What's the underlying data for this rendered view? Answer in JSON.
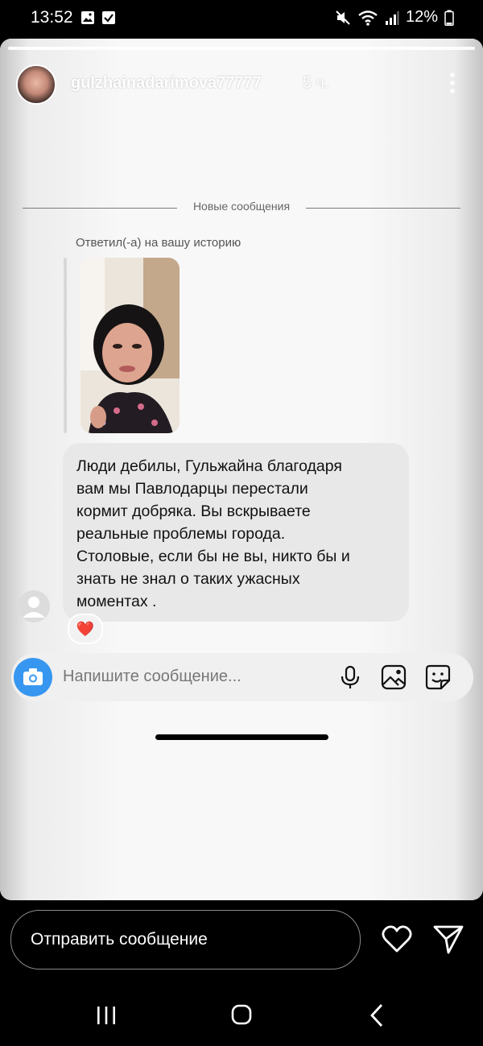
{
  "status_bar": {
    "time": "13:52",
    "battery": "12%",
    "left_icons": [
      "gallery-icon",
      "checkbox-icon"
    ],
    "right_icons": [
      "mute-icon",
      "wifi-icon",
      "signal-icon",
      "battery-icon"
    ]
  },
  "story": {
    "username": "gulzhainadarimova77777",
    "time_ago": "5 ч.",
    "progress": 1.0
  },
  "dm": {
    "divider_label": "Новые сообщения",
    "replied_label": "Ответил(-а) на вашу историю",
    "message": "Люди дебилы, Гульжайна благодаря\nвам мы Павлодарцы перестали\nкормит добряка. Вы вскрываете\nреальные проблемы города.\nСтоловые, если бы не вы, никто бы и\nзнать не знал о таких ужасных\nмоментах .",
    "reaction": "❤️",
    "composer_placeholder": "Напишите сообщение..."
  },
  "reply": {
    "placeholder": "Отправить сообщение"
  },
  "colors": {
    "accent": "#3797f0",
    "bubble": "#e8e8e8",
    "background": "#000000"
  }
}
